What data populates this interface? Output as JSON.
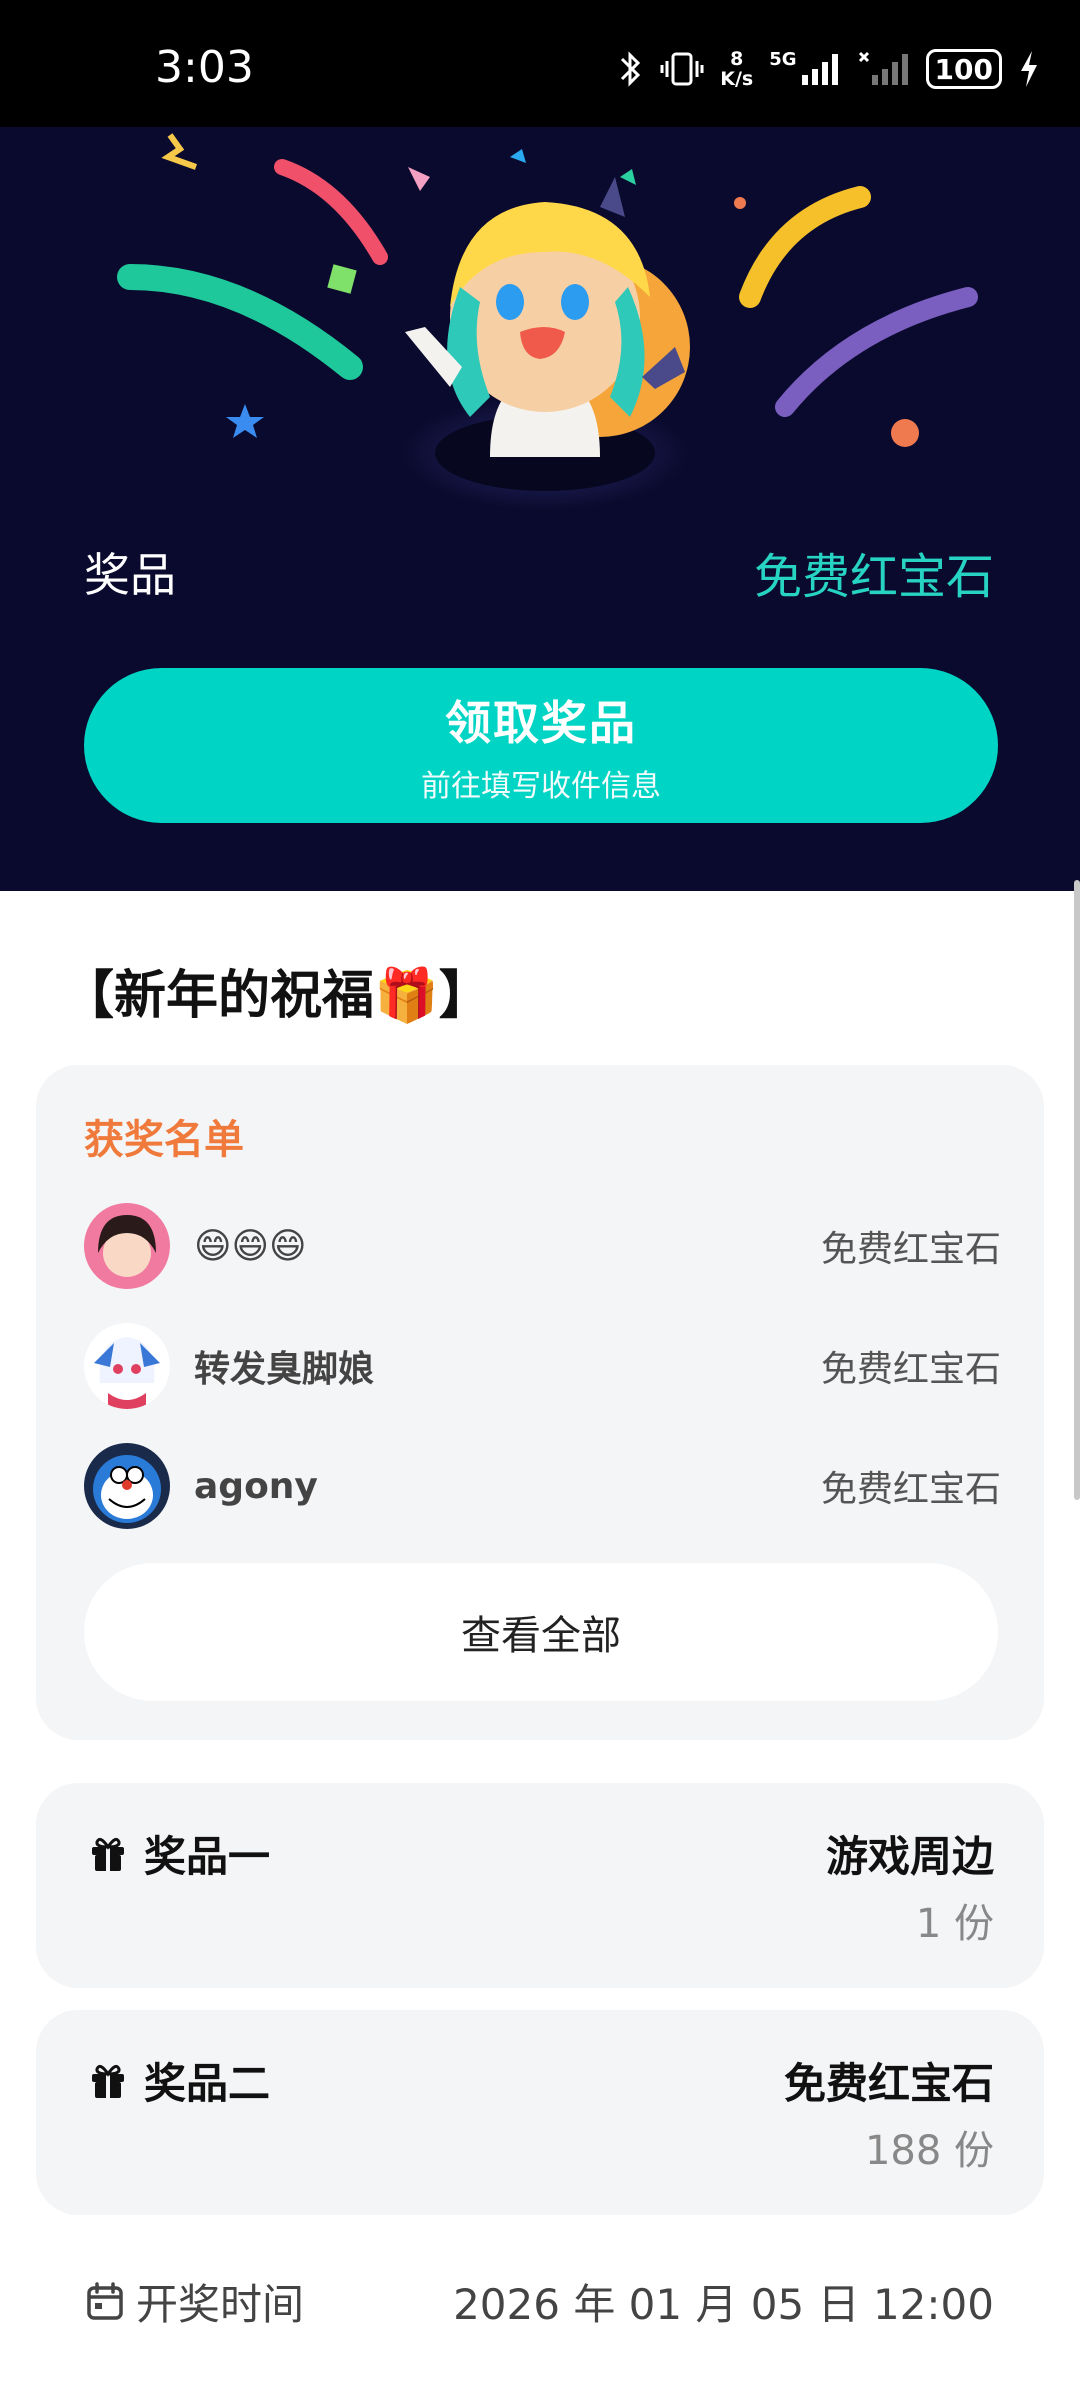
{
  "status_bar": {
    "time": "3:03",
    "net_speed_value": "8",
    "net_speed_unit": "K/s",
    "network_type": "5G",
    "battery": "100"
  },
  "hero": {
    "prize_label": "奖品",
    "prize_value": "免费红宝石",
    "claim_title": "领取奖品",
    "claim_subtitle": "前往填写收件信息",
    "accent_color": "#00d4c4"
  },
  "section": {
    "title": "【新年的祝福🎁】"
  },
  "winners": {
    "heading": "获奖名单",
    "rows": [
      {
        "name": "😄😄😄",
        "prize": "免费红宝石"
      },
      {
        "name": "转发臭脚娘",
        "prize": "免费红宝石"
      },
      {
        "name": "agony",
        "prize": "免费红宝石"
      }
    ],
    "view_all": "查看全部"
  },
  "prizes": [
    {
      "name": "奖品一",
      "value": "游戏周边",
      "quantity": "1 份"
    },
    {
      "name": "奖品二",
      "value": "免费红宝石",
      "quantity": "188 份"
    }
  ],
  "draw": {
    "label": "开奖时间",
    "value": "2026 年 01 月 05 日 12:00"
  },
  "colors": {
    "hero_background": "#0a0a2e",
    "winners_heading": "#f07a3c",
    "prize_value": "#27d3c3"
  }
}
